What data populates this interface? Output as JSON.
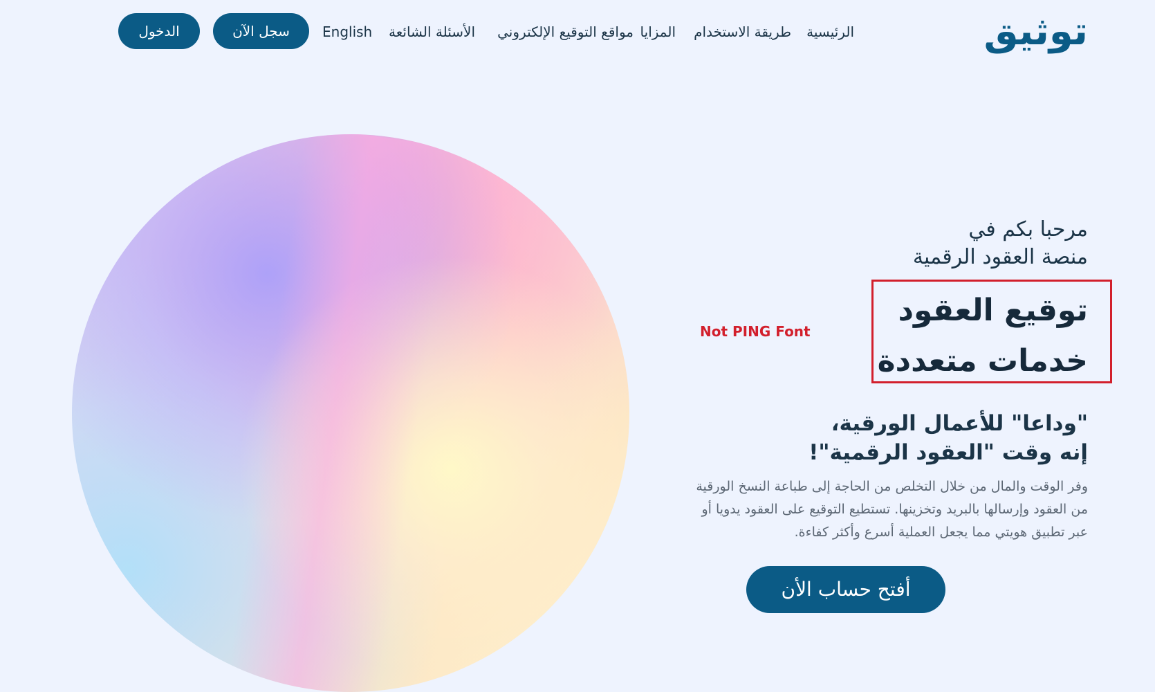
{
  "brand": {
    "logo_text": "توثيق"
  },
  "nav": {
    "home": "الرئيسية",
    "how_to_use": "طريقة الاستخدام",
    "features": "المزايا",
    "esign_sites": "مواقع التوقيع الإلكتروني",
    "faq": "الأسئلة الشائعة",
    "language": "English",
    "register": "سجل الآن",
    "login": "الدخول"
  },
  "hero": {
    "welcome_line1": "مرحبا بكم في",
    "welcome_line2": "منصة العقود الرقمية",
    "headline_line1": "توقيع العقود",
    "headline_line2": "خدمات متعددة",
    "annotation": "Not PING Font",
    "slogan_line1": "\"وداعا\" للأعمال الورقية،",
    "slogan_line2": "إنه وقت \"العقود الرقمية\"!",
    "desc_line1": "وفر الوقت والمال من خلال التخلص من الحاجة إلى طباعة النسخ الورقية",
    "desc_line2": "من العقود وإرسالها بالبريد وتخزينها. تستطيع التوقيع على العقود يدويا أو",
    "desc_line3": "عبر تطبيق هويتي مما يجعل العملية أسرع وأكثر كفاءة.",
    "cta": "أفتح حساب الأن"
  },
  "colors": {
    "background": "#eef3fe",
    "primary": "#0b5b86",
    "annotation_red": "#d21f2c"
  }
}
